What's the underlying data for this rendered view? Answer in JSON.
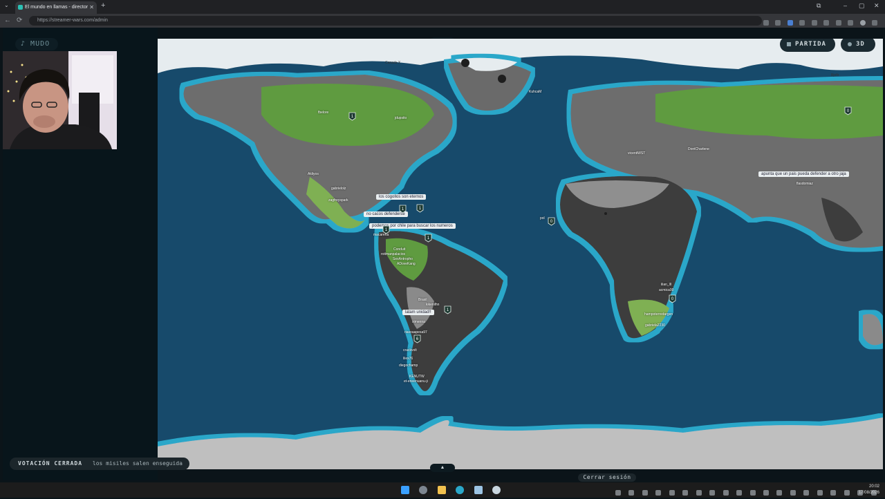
{
  "browser": {
    "tab_title": "El mundo en llamas - director",
    "url": "https://streamer-wars.com/admin"
  },
  "stream": {
    "mute_label": "MUDO",
    "mute_icon": "music-note-icon"
  },
  "map": {
    "mode_button": "PARTIDA",
    "view_button": "3D",
    "region_labels": [
      {
        "text": "fbelore"
      },
      {
        "text": "jdupsito"
      },
      {
        "text": "Canada X"
      },
      {
        "text": "KuhcaM"
      },
      {
        "text": "Akliyos"
      },
      {
        "text": "gabrielolz"
      },
      {
        "text": "zagfreyspark"
      },
      {
        "text": "vicentiWST"
      },
      {
        "text": "DontCharlene"
      },
      {
        "text": "macarena"
      },
      {
        "text": "pol"
      },
      {
        "text": "Conduit"
      },
      {
        "text": "roitmanpalacios"
      },
      {
        "text": "SexAntropho"
      },
      {
        "text": "ADoveKang"
      },
      {
        "text": "ilian_lll"
      },
      {
        "text": "acmica00"
      },
      {
        "text": "hampoterredargen"
      },
      {
        "text": "gabriela2230"
      },
      {
        "text": "Brasil"
      },
      {
        "text": "kikenilhn"
      },
      {
        "text": "ximenna"
      },
      {
        "text": "riasoaapesa97"
      },
      {
        "text": "crackvolt"
      },
      {
        "text": "lilex76"
      },
      {
        "text": "diegochamp"
      },
      {
        "text": "KENUTW"
      },
      {
        "text": "et-eneenuanu-ji"
      },
      {
        "text": "flasdomiaz"
      },
      {
        "text": "Bjofir"
      }
    ],
    "chat_bubbles": [
      {
        "text": "los cogollos son eternos"
      },
      {
        "text": "no cacos defenderse"
      },
      {
        "text": "podemos por chile para buscar los numeros"
      },
      {
        "text": "latam unidad!!"
      },
      {
        "text": "apunta que un pais pueda defender a otro jaja"
      }
    ],
    "markers": [
      {
        "count": "1"
      },
      {
        "count": "1"
      },
      {
        "count": "1"
      },
      {
        "count": "1"
      },
      {
        "count": "1"
      },
      {
        "count": "1"
      },
      {
        "count": "6"
      },
      {
        "count": "0"
      },
      {
        "count": "0"
      },
      {
        "count": "0"
      }
    ]
  },
  "vote_bar": {
    "status": "VOTACIÓN CERRADA",
    "message": "los misiles salen enseguida"
  },
  "logout_label": "Cerrar sesión",
  "taskbar": {
    "time": "20:02",
    "date": "17/08/2026"
  },
  "colors": {
    "ocean": "#174a6b",
    "coast_glow": "#2aa7c9",
    "land_gray": "#6a6a6a",
    "land_dark": "#3d3d3d",
    "land_green": "#5f9b40",
    "ice": "#e6ecef",
    "panel": "#08151b"
  }
}
